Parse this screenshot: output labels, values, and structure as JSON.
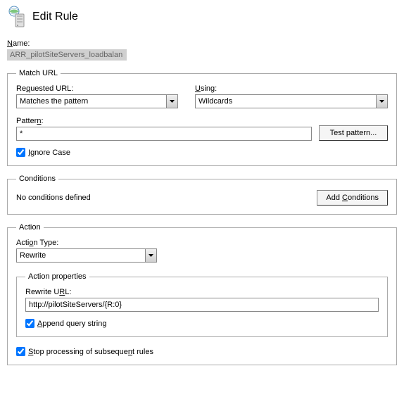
{
  "header": {
    "title": "Edit Rule"
  },
  "name": {
    "label": "Name:",
    "value": "ARR_pilotSiteServers_loadbalan"
  },
  "matchUrl": {
    "legend": "Match URL",
    "requestedUrl": {
      "label": "Requested URL:",
      "value": "Matches the pattern"
    },
    "using": {
      "label": "Using:",
      "value": "Wildcards"
    },
    "pattern": {
      "label": "Pattern:",
      "value": "*",
      "testBtn": "Test pattern..."
    },
    "ignoreCase": {
      "label": "Ignore Case",
      "checked": true
    }
  },
  "conditions": {
    "legend": "Conditions",
    "empty": "No conditions defined",
    "addBtn": "Add Conditions"
  },
  "action": {
    "legend": "Action",
    "typeLabel": "Action Type:",
    "typeValue": "Rewrite",
    "properties": {
      "legend": "Action properties",
      "rewriteUrlLabel": "Rewrite URL:",
      "rewriteUrlValue": "http://pilotSiteServers/{R:0}",
      "appendQuery": {
        "label": "Append query string",
        "checked": true
      }
    },
    "stopProcessing": {
      "label": "Stop processing of subsequent rules",
      "checked": true
    }
  }
}
